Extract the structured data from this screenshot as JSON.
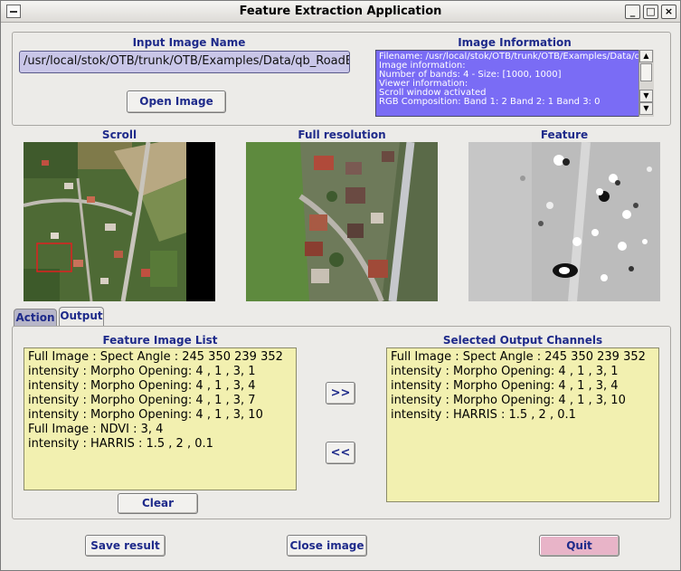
{
  "window": {
    "title": "Feature Extraction Application",
    "buttons": {
      "minimize": "_",
      "maximize": "□",
      "close": "×"
    }
  },
  "input": {
    "label": "Input Image Name",
    "value": "/usr/local/stok/OTB/trunk/OTB/Examples/Data/qb_RoadExtract.tif",
    "open_button": "Open Image"
  },
  "image_info": {
    "label": "Image Information",
    "lines": [
      "Filename: /usr/local/stok/OTB/trunk/OTB/Examples/Data/qb_Ro",
      "Image information:",
      "Number of bands: 4 - Size: [1000, 1000]",
      "Viewer information:",
      "Scroll window activated",
      "RGB Composition:  Band 1: 2 Band 2: 1 Band 3: 0"
    ]
  },
  "views": {
    "scroll_label": "Scroll",
    "full_label": "Full resolution",
    "feature_label": "Feature"
  },
  "tabs": [
    "Action",
    "Output"
  ],
  "feature_list": {
    "label": "Feature Image List",
    "items": [
      "Full Image : Spect Angle : 245 350 239 352",
      "intensity : Morpho Opening: 4 , 1 , 3, 1",
      "intensity : Morpho Opening: 4 , 1 , 3, 4",
      "intensity : Morpho Opening: 4 , 1 , 3, 7",
      "intensity : Morpho Opening: 4 , 1 , 3, 10",
      "Full Image : NDVI : 3, 4",
      "intensity : HARRIS : 1.5 , 2 , 0.1"
    ],
    "clear_button": "Clear"
  },
  "transfer": {
    "add": ">>",
    "remove": "<<"
  },
  "output_list": {
    "label": "Selected Output Channels",
    "items": [
      "Full Image : Spect Angle : 245 350 239 352",
      "intensity : Morpho Opening: 4 , 1 , 3, 1",
      "intensity : Morpho Opening: 4 , 1 , 3, 4",
      "intensity : Morpho Opening: 4 , 1 , 3, 10",
      "intensity : HARRIS : 1.5 , 2 , 0.1"
    ]
  },
  "bottom": {
    "save": "Save result",
    "close": "Close image",
    "quit": "Quit"
  },
  "colors": {
    "label_blue": "#1e2a8a",
    "input_bg": "#c9c6e8",
    "info_bg": "#7a6cf5",
    "list_bg": "#f2f0b0",
    "quit_bg": "#e8b4c8"
  }
}
